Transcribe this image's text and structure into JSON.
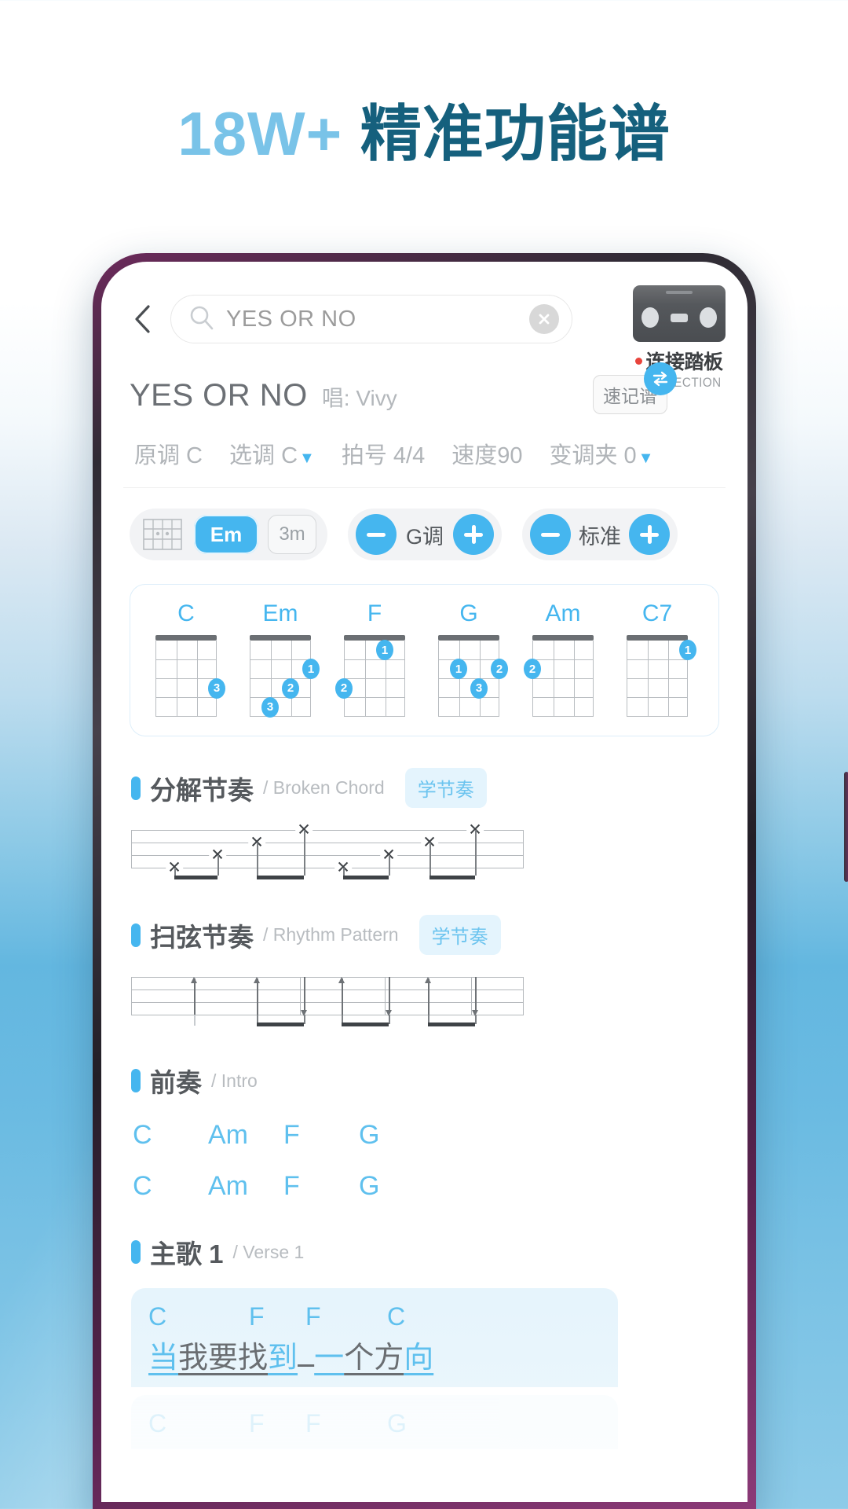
{
  "headline": {
    "number": "18W+",
    "text": "精准功能谱"
  },
  "app": {
    "search": {
      "value": "YES OR NO",
      "icon": "search-icon",
      "clear_icon": "clear-icon",
      "back_icon": "back-chevron-icon"
    },
    "pedal": {
      "cn_label": "连接踏板",
      "en_label": "CONNECTION"
    },
    "song": {
      "title": "YES OR NO",
      "artist_prefix": "唱: ",
      "artist": "Vivy",
      "quick_sheet": "速记谱"
    },
    "meta": [
      {
        "name": "original-key",
        "label": "原调 C",
        "caret": false
      },
      {
        "name": "selected-key",
        "label": "选调 C",
        "caret": true
      },
      {
        "name": "time-signature",
        "label": "拍号 4/4",
        "caret": false
      },
      {
        "name": "tempo",
        "label": "速度90",
        "caret": false
      },
      {
        "name": "capo",
        "label": "变调夹 0",
        "caret": true
      }
    ],
    "controls": {
      "grid_icon": "fretboard-icon",
      "chip_on": "Em",
      "chip_off": "3m",
      "key_stepper": {
        "value": "G调",
        "minus": "−",
        "plus": "+"
      },
      "tuning_stepper": {
        "value": "标准",
        "minus": "−",
        "plus": "+"
      }
    },
    "chords": [
      {
        "name": "C",
        "dots": [
          {
            "string": 4,
            "fret": 3,
            "finger": "3"
          }
        ]
      },
      {
        "name": "Em",
        "dots": [
          {
            "string": 4,
            "fret": 2,
            "finger": "1"
          },
          {
            "string": 3,
            "fret": 3,
            "finger": "2"
          },
          {
            "string": 2,
            "fret": 4,
            "finger": "3"
          }
        ]
      },
      {
        "name": "F",
        "dots": [
          {
            "string": 3,
            "fret": 1,
            "finger": "1"
          },
          {
            "string": 1,
            "fret": 3,
            "finger": "2"
          }
        ]
      },
      {
        "name": "G",
        "dots": [
          {
            "string": 2,
            "fret": 2,
            "finger": "1"
          },
          {
            "string": 4,
            "fret": 2,
            "finger": "2"
          },
          {
            "string": 3,
            "fret": 3,
            "finger": "3"
          }
        ]
      },
      {
        "name": "Am",
        "dots": [
          {
            "string": 1,
            "fret": 2,
            "finger": "2"
          }
        ]
      },
      {
        "name": "C7",
        "dots": [
          {
            "string": 4,
            "fret": 1,
            "finger": "1"
          }
        ]
      }
    ],
    "sections": {
      "broken_chord": {
        "cn": "分解节奏",
        "en": "/ Broken Chord",
        "learn": "学节奏"
      },
      "rhythm_pattern": {
        "cn": "扫弦节奏",
        "en": "/ Rhythm Pattern",
        "learn": "学节奏"
      },
      "intro": {
        "cn": "前奏",
        "en": "/ Intro"
      },
      "verse1": {
        "cn": "主歌 1",
        "en": "/ Verse 1"
      }
    },
    "intro_lines": [
      [
        "C",
        "Am",
        "F",
        "G"
      ],
      [
        "C",
        "Am",
        "F",
        "G"
      ]
    ],
    "verse1": [
      {
        "chords": [
          "C",
          "F",
          "F",
          "C"
        ],
        "lyric_parts": [
          {
            "text": "当",
            "highlight": true
          },
          {
            "text": "我要找",
            "highlight": false
          },
          {
            "text": "到",
            "highlight": true
          },
          {
            "text": "  ",
            "highlight": false
          },
          {
            "text": "一",
            "highlight": true
          },
          {
            "text": "个方",
            "highlight": false
          },
          {
            "text": "向",
            "highlight": true
          }
        ]
      },
      {
        "chords": [
          "C",
          "F",
          "F",
          "G"
        ],
        "lyric_parts": []
      }
    ]
  },
  "colors": {
    "accent": "#45b6ef",
    "accent_light": "#5fc0ee",
    "headline_dark": "#15607d",
    "headline_light": "#79c3e8",
    "muted": "#b0b4b8"
  }
}
